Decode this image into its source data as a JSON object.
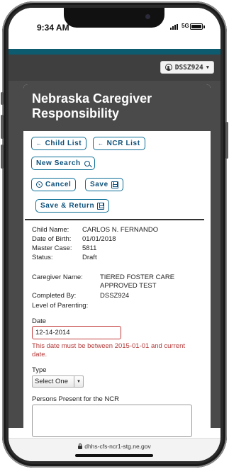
{
  "status_bar": {
    "time": "9:34 AM",
    "network": "5G"
  },
  "header": {
    "user_id": "DSSZ924"
  },
  "card": {
    "title": "Nebraska Caregiver Responsibility",
    "buttons": {
      "child_list": "Child List",
      "ncr_list": "NCR List",
      "new_search": "New Search",
      "cancel": "Cancel",
      "save": "Save",
      "save_return": "Save & Return"
    },
    "child": {
      "name_label": "Child Name:",
      "name_value": "CARLOS N. FERNANDO",
      "dob_label": "Date of Birth:",
      "dob_value": "01/01/2018",
      "master_case_label": "Master Case:",
      "master_case_value": "5811",
      "status_label": "Status:",
      "status_value": "Draft"
    },
    "caregiver": {
      "name_label": "Caregiver Name:",
      "name_value_line1": "TIERED FOSTER CARE",
      "name_value_line2": "APPROVED TEST",
      "completed_by_label": "Completed By:",
      "completed_by_value": "DSSZ924",
      "level_label": "Level of Parenting:"
    },
    "form": {
      "date_label": "Date",
      "date_value": "12-14-2014",
      "date_error": "This date must be between 2015-01-01 and current date.",
      "type_label": "Type",
      "type_selected": "Select One",
      "persons_label": "Persons Present for the NCR"
    }
  },
  "browser": {
    "url": "dhhs-cfs-ncr1-stg.ne.gov"
  },
  "colors": {
    "teal_bar": "#0c5b6e",
    "button_border": "#0c6e96",
    "error": "#b53a3a"
  },
  "icons": [
    "user-circle-icon",
    "caret-down-icon",
    "arrow-left-icon",
    "search-icon",
    "cancel-circle-icon",
    "save-disk-icon",
    "lock-icon"
  ]
}
